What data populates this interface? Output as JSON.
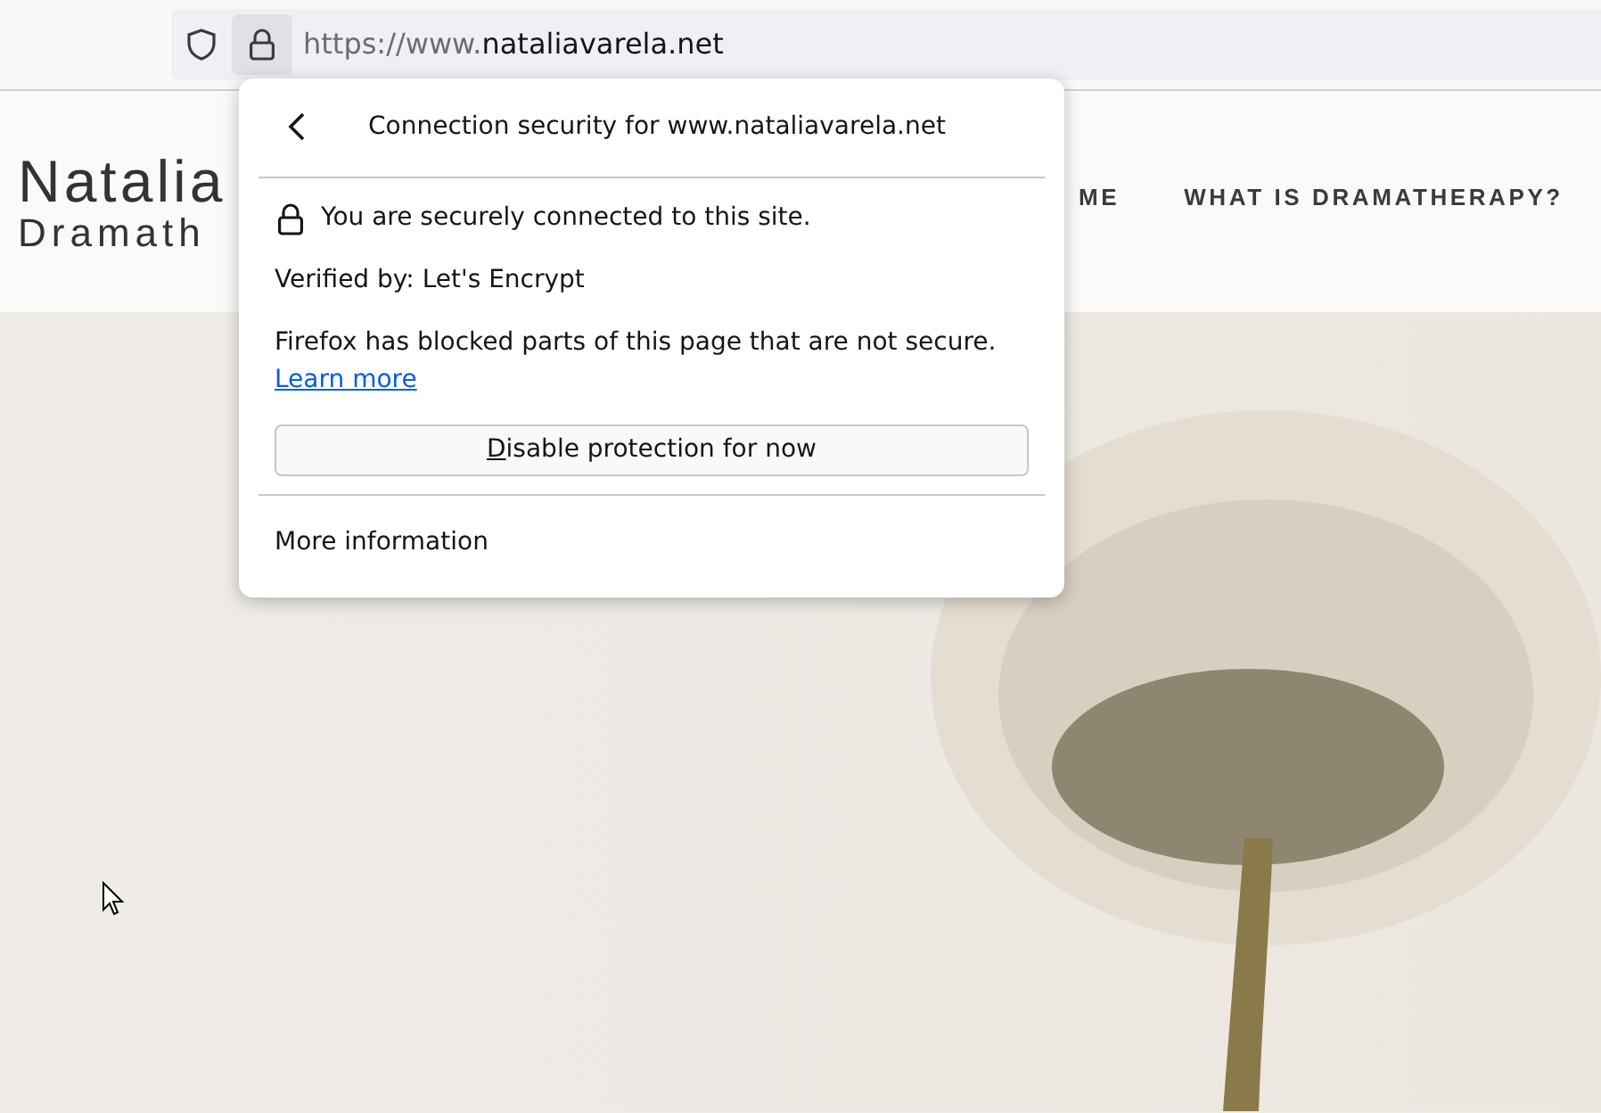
{
  "address_bar": {
    "url_prefix": "https://www.",
    "url_host": "nataliavarela.net",
    "lock_selected": true
  },
  "site": {
    "logo_lines": [
      "Natalia",
      "Dramath"
    ],
    "nav": [
      "ME",
      "WHAT IS DRAMATHERAPY?"
    ]
  },
  "popup": {
    "title": "Connection security for www.nataliavarela.net",
    "secure_text": "You are securely connected to this site.",
    "verified": "Verified by: Let's Encrypt",
    "blocked_text": "Firefox has blocked parts of this page that are not secure.",
    "learn_more": "Learn more",
    "button": "Disable protection for now",
    "more_info": "More information"
  }
}
